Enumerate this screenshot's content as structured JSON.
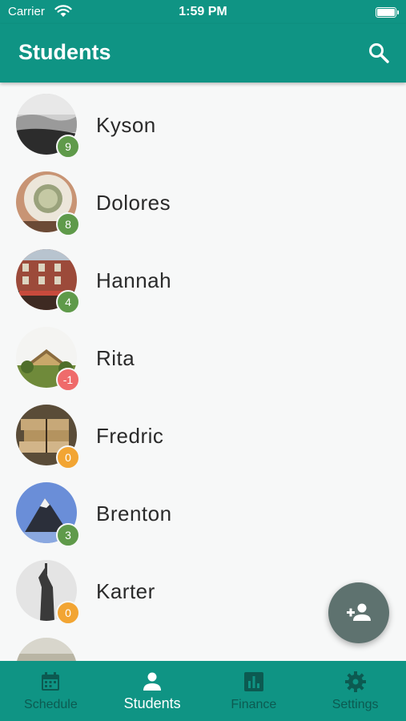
{
  "status_bar": {
    "carrier": "Carrier",
    "time": "1:59 PM"
  },
  "app_bar": {
    "title": "Students",
    "search_icon": "search-icon"
  },
  "students": [
    {
      "name": "Kyson",
      "badge": "9",
      "badge_color": "#5f9a4a"
    },
    {
      "name": "Dolores",
      "badge": "8",
      "badge_color": "#5f9a4a"
    },
    {
      "name": "Hannah",
      "badge": "4",
      "badge_color": "#5f9a4a"
    },
    {
      "name": "Rita",
      "badge": "-1",
      "badge_color": "#ef6b6b"
    },
    {
      "name": "Fredric",
      "badge": "0",
      "badge_color": "#f2a533"
    },
    {
      "name": "Brenton",
      "badge": "3",
      "badge_color": "#5f9a4a"
    },
    {
      "name": "Karter",
      "badge": "0",
      "badge_color": "#f2a533"
    }
  ],
  "fab": {
    "icon": "add-person-icon"
  },
  "bottom_nav": [
    {
      "label": "Schedule",
      "icon": "calendar-icon"
    },
    {
      "label": "Students",
      "icon": "person-icon"
    },
    {
      "label": "Finance",
      "icon": "bar-chart-icon"
    },
    {
      "label": "Settings",
      "icon": "gear-icon"
    }
  ],
  "colors": {
    "primary": "#0f9484",
    "nav_inactive": "#0c5a51",
    "fab": "#5e726f"
  }
}
